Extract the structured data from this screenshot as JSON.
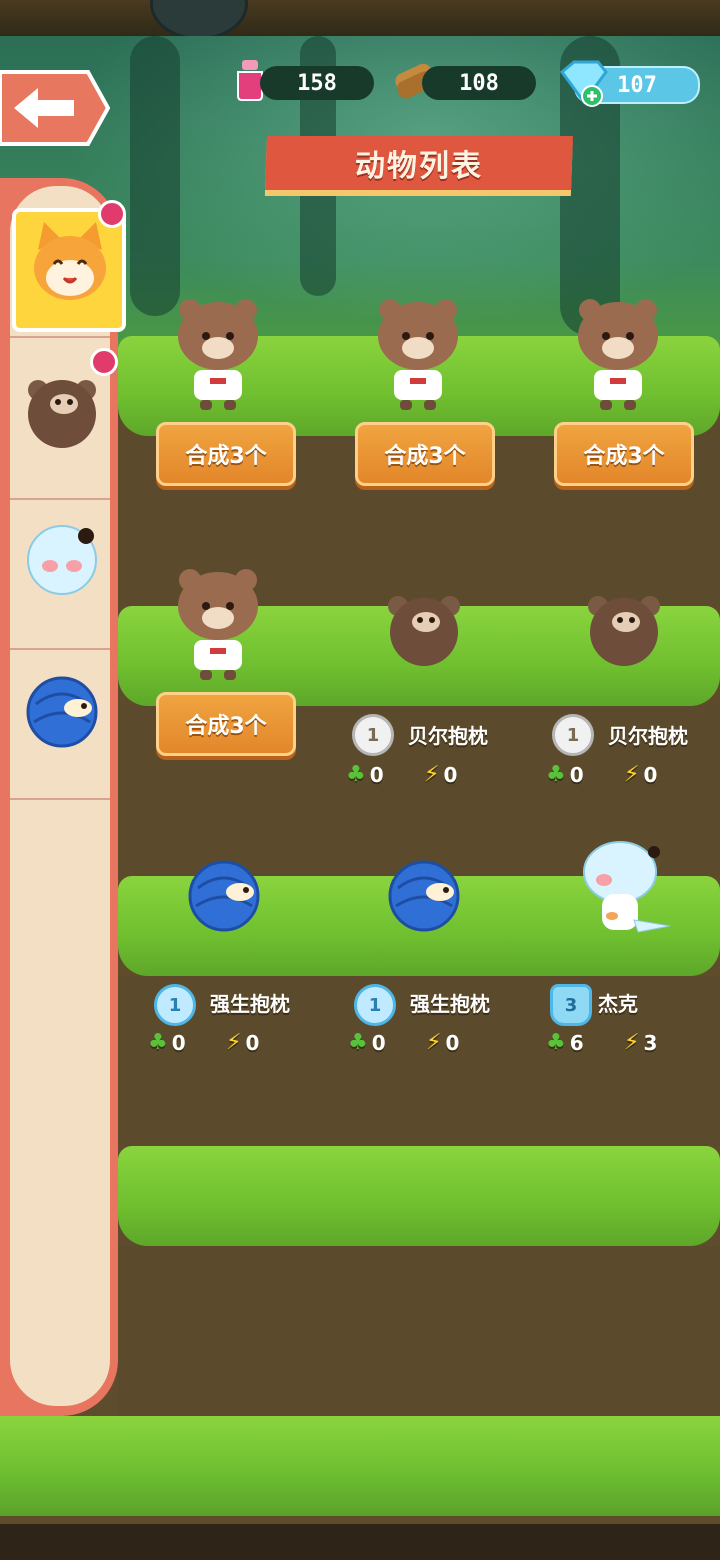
{
  "header": {
    "title": "动物列表",
    "resources": [
      {
        "name": "potion",
        "value": "158"
      },
      {
        "name": "wood",
        "value": "108"
      },
      {
        "name": "gem",
        "value": "107"
      }
    ]
  },
  "sidebar": {
    "tabs": [
      {
        "name": "cat",
        "selected": true,
        "badge": true
      },
      {
        "name": "brown-bear",
        "selected": false,
        "badge": true
      },
      {
        "name": "white-seal",
        "selected": false,
        "badge": false
      },
      {
        "name": "blue-pangolin",
        "selected": false,
        "badge": false
      }
    ]
  },
  "cards": [
    {
      "type": "merge",
      "label": "合成3个"
    },
    {
      "type": "merge",
      "label": "合成3个"
    },
    {
      "type": "merge",
      "label": "合成3个"
    },
    {
      "type": "merge",
      "label": "合成3个"
    },
    {
      "type": "animal",
      "level": "1",
      "name": "贝尔抱枕",
      "clover": "0",
      "energy": "0"
    },
    {
      "type": "animal",
      "level": "1",
      "name": "贝尔抱枕",
      "clover": "0",
      "energy": "0"
    },
    {
      "type": "animal",
      "level": "1",
      "name": "强生抱枕",
      "clover": "0",
      "energy": "0"
    },
    {
      "type": "animal",
      "level": "1",
      "name": "强生抱枕",
      "clover": "0",
      "energy": "0"
    },
    {
      "type": "animal",
      "level": "3",
      "name": "杰克",
      "clover": "6",
      "energy": "3"
    }
  ],
  "colors": {
    "accent": "#e0573f",
    "button": "#e2872a",
    "grass": "#7fcb37"
  }
}
